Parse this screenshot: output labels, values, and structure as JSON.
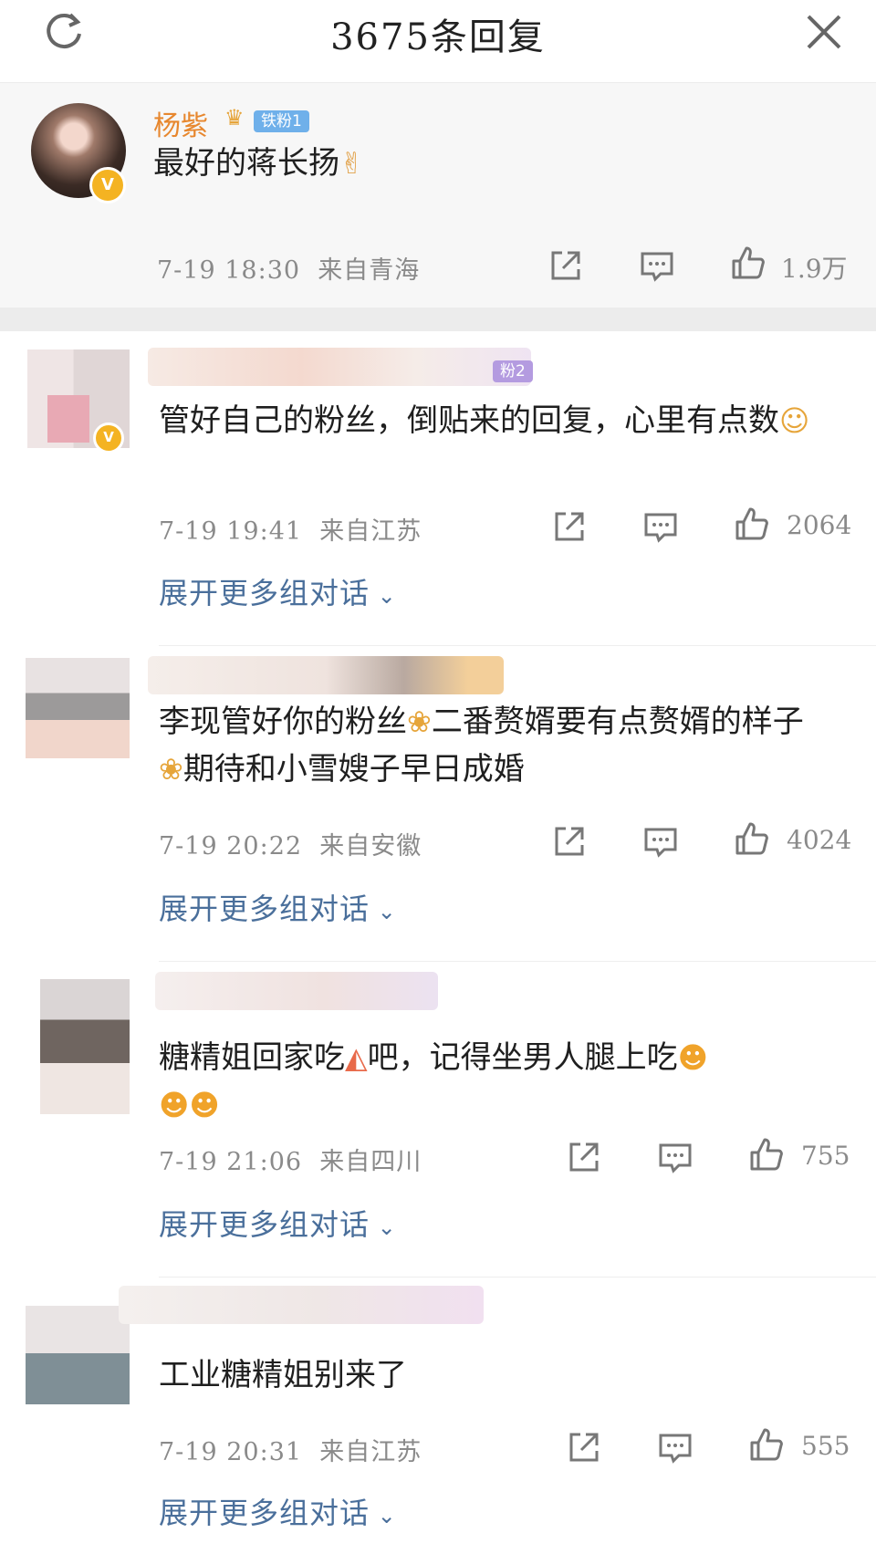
{
  "header": {
    "title": "3675条回复"
  },
  "comments": [
    {
      "name": "杨紫",
      "fan_badge": "铁粉1",
      "text": "最好的蒋长扬",
      "emoji": "✌",
      "time": "7-19 18:30",
      "location": "来自青海",
      "likes": "1.9万"
    },
    {
      "fan_badge": "粉2",
      "text": "管好自己的粉丝，倒贴来的回复，心里有点数",
      "emoji": "☺",
      "time": "7-19 19:41",
      "location": "来自江苏",
      "likes": "2064",
      "expand": "展开更多组对话"
    },
    {
      "text_a": "李现管好你的粉丝",
      "text_b": "二番赘婿要有点赘婿的样子",
      "text_c": "期待和小雪嫂子早日成婚",
      "time": "7-19 20:22",
      "location": "来自安徽",
      "likes": "4024",
      "expand": "展开更多组对话"
    },
    {
      "text_a": "糖精姐回家吃",
      "text_b": "吧，记得坐男人腿上吃",
      "time": "7-19 21:06",
      "location": "来自四川",
      "likes": "755",
      "expand": "展开更多组对话"
    },
    {
      "text": "工业糖精姐别来了",
      "time": "7-19 20:31",
      "location": "来自江苏",
      "likes": "555",
      "expand": "展开更多组对话"
    }
  ],
  "colors": {
    "name": "#e7872e",
    "link": "#4a6f9b",
    "meta": "#8a8a8a",
    "fan_badge": "#6fb0ea",
    "verified": "#f4b322"
  },
  "icons": {
    "refresh": "refresh-icon",
    "close": "close-icon",
    "share": "share-icon",
    "comment": "comment-icon",
    "like": "like-icon"
  }
}
